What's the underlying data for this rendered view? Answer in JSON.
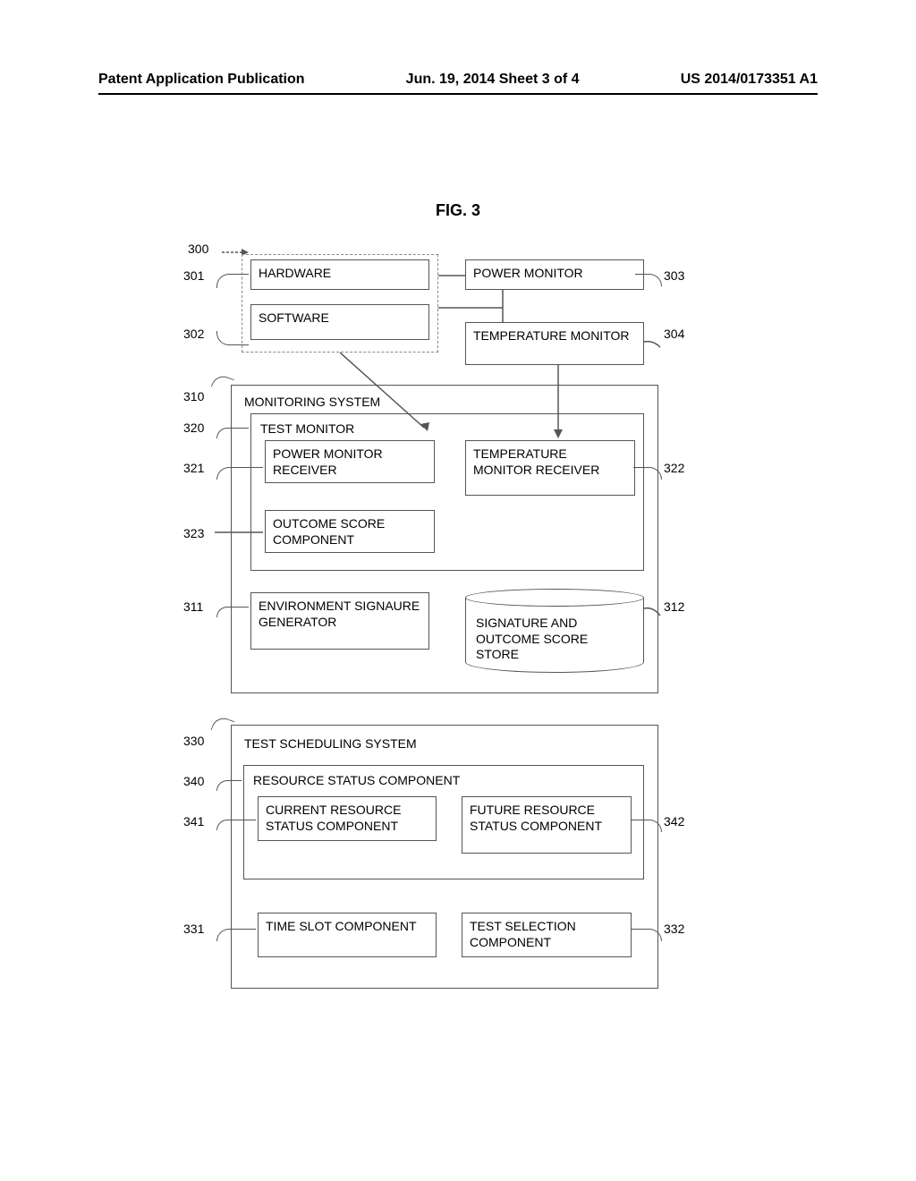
{
  "header": {
    "left": "Patent Application Publication",
    "center": "Jun. 19, 2014  Sheet 3 of 4",
    "right": "US 2014/0173351 A1"
  },
  "figure": {
    "title": "FIG. 3"
  },
  "refs": {
    "r300": "300",
    "r301": "301",
    "r302": "302",
    "r303": "303",
    "r304": "304",
    "r310": "310",
    "r311": "311",
    "r312": "312",
    "r320": "320",
    "r321": "321",
    "r322": "322",
    "r323": "323",
    "r330": "330",
    "r331": "331",
    "r332": "332",
    "r340": "340",
    "r341": "341",
    "r342": "342"
  },
  "boxes": {
    "hardware": "HARDWARE",
    "software": "SOFTWARE",
    "power_monitor": "POWER MONITOR",
    "temp_monitor": "TEMPERATURE MONITOR",
    "monitoring_system": "MONITORING SYSTEM",
    "test_monitor": "TEST MONITOR",
    "power_monitor_recv": "POWER MONITOR RECEIVER",
    "temp_monitor_recv": "TEMPERATURE MONITOR RECEIVER",
    "outcome_score": "OUTCOME SCORE COMPONENT",
    "env_sig_gen": "ENVIRONMENT SIGNAURE GENERATOR",
    "sig_store": "SIGNATURE AND OUTCOME SCORE STORE",
    "test_sched": "TEST SCHEDULING SYSTEM",
    "resource_status": "RESOURCE STATUS COMPONENT",
    "current_resource": "CURRENT RESOURCE STATUS COMPONENT",
    "future_resource": "FUTURE RESOURCE STATUS COMPONENT",
    "time_slot": "TIME SLOT COMPONENT",
    "test_selection": "TEST SELECTION COMPONENT"
  }
}
